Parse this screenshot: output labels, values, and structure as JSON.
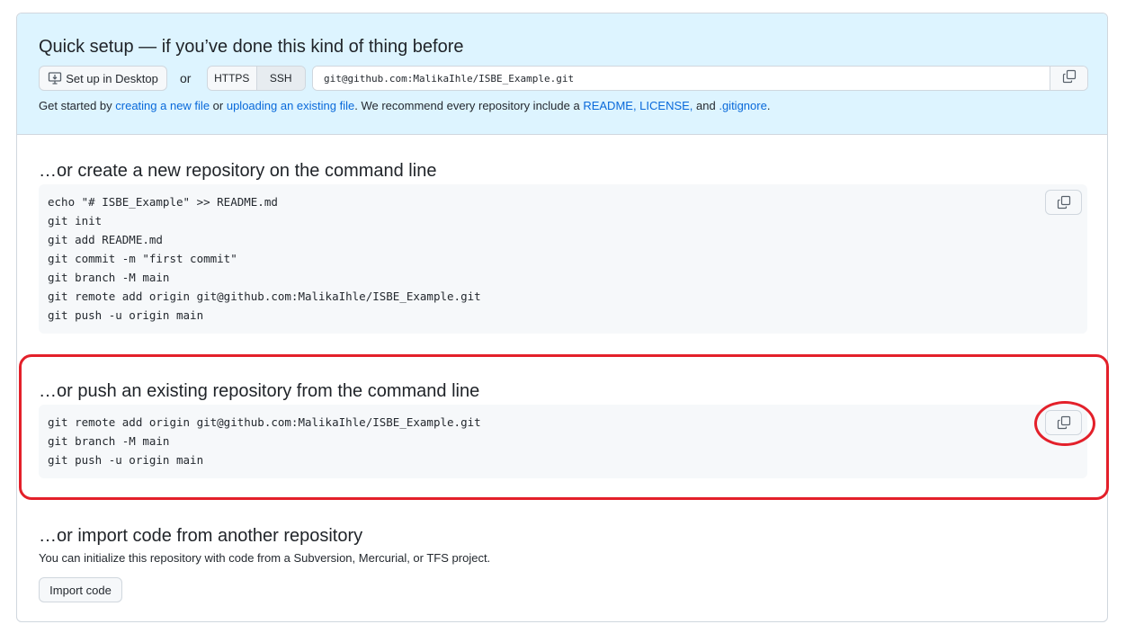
{
  "quick_setup": {
    "title": "Quick setup — if you’ve done this kind of thing before",
    "desktop_button": "Set up in Desktop",
    "or": "or",
    "https_tab": "HTTPS",
    "ssh_tab": "SSH",
    "clone_url": "git@github.com:MalikaIhle/ISBE_Example.git",
    "getstarted": {
      "prefix": "Get started by ",
      "link_new_file": "creating a new file",
      "or": " or ",
      "link_upload": "uploading an existing file",
      "middle": ". We recommend every repository include a ",
      "link_readme_license": "README, LICENSE,",
      "and": " and ",
      "link_gitignore": ".gitignore",
      "suffix": "."
    }
  },
  "new_repo": {
    "title": "…or create a new repository on the command line",
    "code": "echo \"# ISBE_Example\" >> README.md\ngit init\ngit add README.md\ngit commit -m \"first commit\"\ngit branch -M main\ngit remote add origin git@github.com:MalikaIhle/ISBE_Example.git\ngit push -u origin main"
  },
  "push_existing": {
    "title": "…or push an existing repository from the command line",
    "code": "git remote add origin git@github.com:MalikaIhle/ISBE_Example.git\ngit branch -M main\ngit push -u origin main"
  },
  "import_section": {
    "title": "…or import code from another repository",
    "description": "You can initialize this repository with code from a Subversion, Mercurial, or TFS project.",
    "button": "Import code"
  },
  "icons": {
    "desktop": "desktop-download-icon",
    "copy": "copy-icon"
  },
  "colors": {
    "accent_link": "#0969da",
    "quick_setup_bg": "#ddf4ff",
    "highlight": "#e3202a"
  }
}
